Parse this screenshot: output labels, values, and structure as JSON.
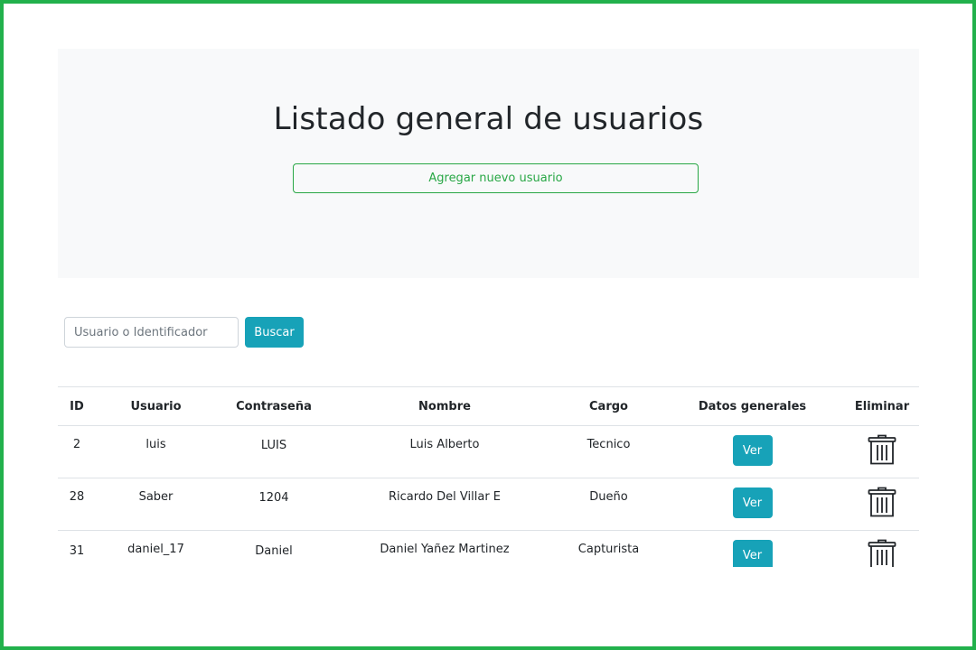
{
  "header": {
    "title": "Listado general de usuarios",
    "add_button": "Agregar nuevo usuario"
  },
  "search": {
    "placeholder": "Usuario o Identificador",
    "button": "Buscar"
  },
  "table": {
    "columns": [
      "ID",
      "Usuario",
      "Contraseña",
      "Nombre",
      "Cargo",
      "Datos generales",
      "Eliminar"
    ],
    "rows": [
      {
        "id": "2",
        "usuario": "luis",
        "contrasena": "LUIS",
        "nombre": "Luis Alberto",
        "cargo": "Tecnico",
        "ver": "Ver",
        "delete_icon": "trash-icon"
      },
      {
        "id": "28",
        "usuario": "Saber",
        "contrasena": "1204",
        "nombre": "Ricardo Del Villar E",
        "cargo": "Dueño",
        "ver": "Ver",
        "delete_icon": "trash-icon"
      },
      {
        "id": "31",
        "usuario": "daniel_17",
        "contrasena": "Daniel",
        "nombre": "Daniel Yañez Martinez",
        "cargo": "Capturista",
        "ver": "Ver",
        "delete_icon": "trash-icon"
      }
    ]
  },
  "colors": {
    "border": "#22b14c",
    "success": "#28a745",
    "info": "#17a2b8",
    "jumbotron": "#f8f9fa"
  }
}
